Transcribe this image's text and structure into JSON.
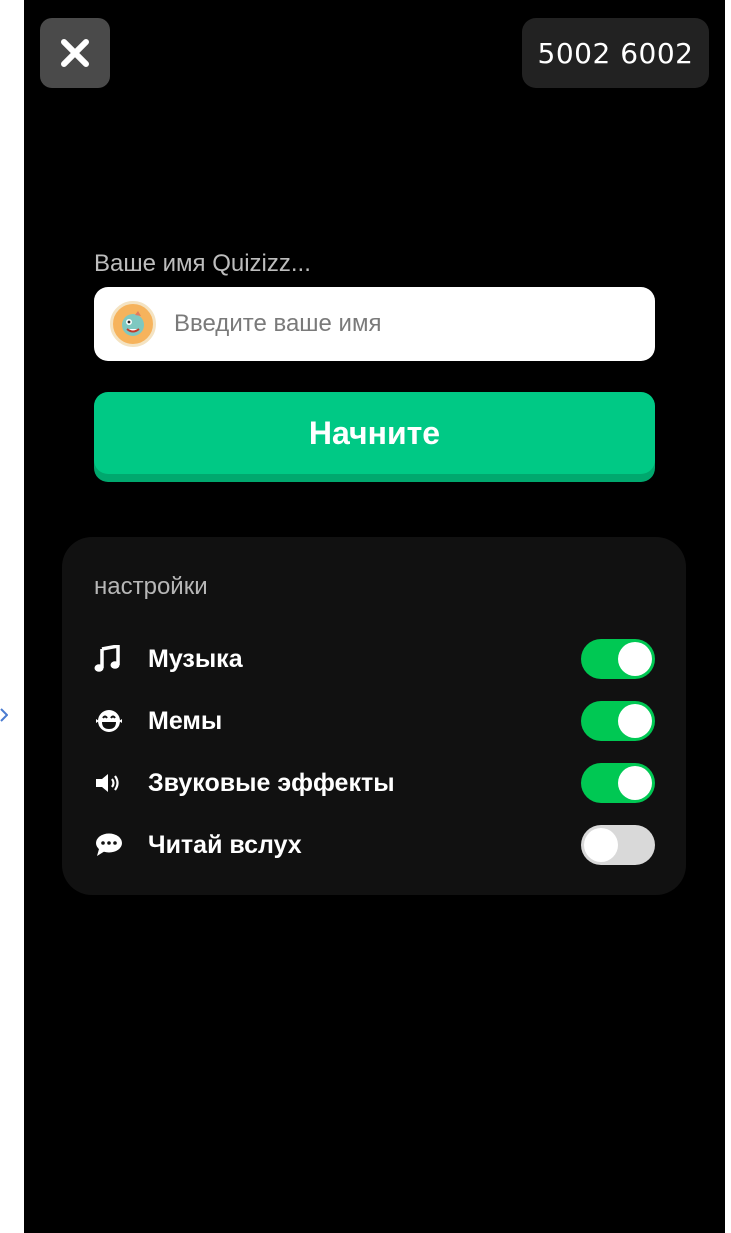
{
  "header": {
    "close_icon": "close-icon",
    "game_code": "5002 6002"
  },
  "join": {
    "name_label": "Ваше имя Quizizz...",
    "name_placeholder": "Введите ваше имя",
    "name_value": "",
    "avatar_icon": "avatar-icon",
    "start_label": "Начните",
    "accent_color": "#00c985"
  },
  "settings": {
    "title": "настройки",
    "items": [
      {
        "label": "Музыка",
        "icon": "music-note-icon",
        "enabled": true
      },
      {
        "label": "Мемы",
        "icon": "laughing-face-icon",
        "enabled": true
      },
      {
        "label": "Звуковые эффекты",
        "icon": "speaker-icon",
        "enabled": true
      },
      {
        "label": "Читай вслух",
        "icon": "speech-bubble-icon",
        "enabled": false
      }
    ],
    "toggle_on_color": "#00c853",
    "toggle_off_color": "#d9d9d9"
  }
}
